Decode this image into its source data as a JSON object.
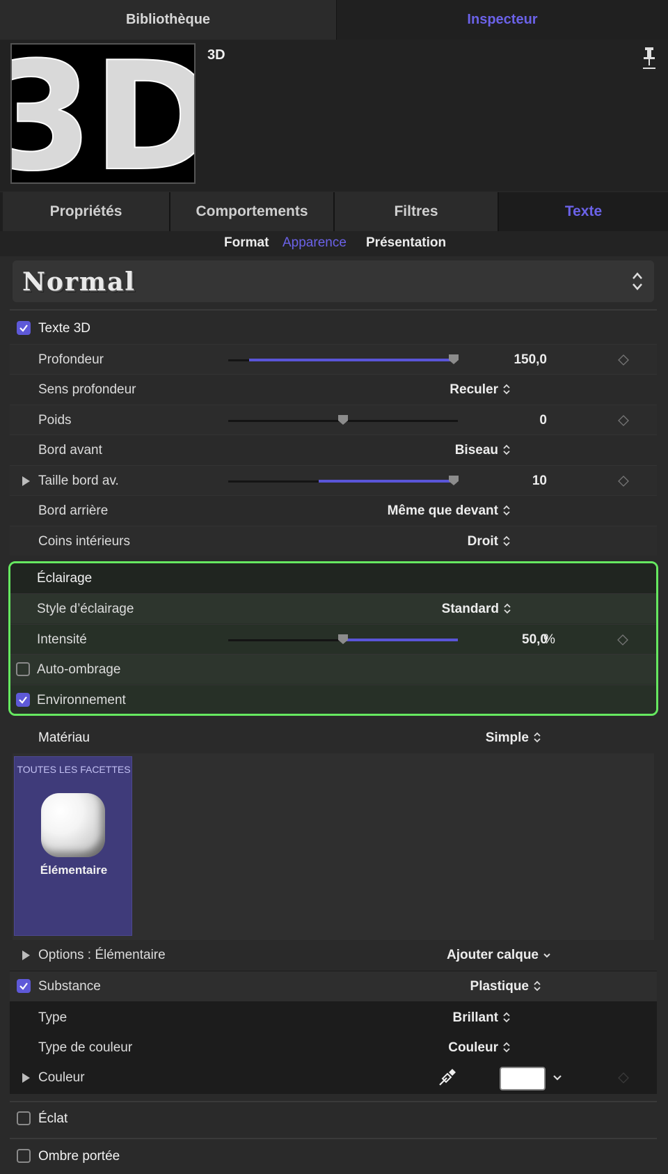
{
  "top_tabs": {
    "library": "Bibliothèque",
    "inspector": "Inspecteur"
  },
  "header": {
    "name": "3D",
    "thumbnail_text": "3D"
  },
  "inspector_tabs": [
    "Propriétés",
    "Comportements",
    "Filtres",
    "Texte"
  ],
  "sub_tabs": [
    "Format",
    "Apparence",
    "Présentation"
  ],
  "preset": {
    "label": "Normal"
  },
  "text3d": {
    "label": "Texte 3D",
    "checked": true,
    "depth": {
      "label": "Profondeur",
      "value": "150,0",
      "fraction": 0.98
    },
    "depth_dir": {
      "label": "Sens profondeur",
      "value": "Reculer"
    },
    "weight": {
      "label": "Poids",
      "value": "0",
      "fraction": 0.5
    },
    "front_edge": {
      "label": "Bord avant",
      "value": "Biseau"
    },
    "front_edge_size": {
      "label": "Taille bord av.",
      "value": "10",
      "fraction": 0.98,
      "fill_from": 0.4
    },
    "back_edge": {
      "label": "Bord arrière",
      "value": "Même que devant"
    },
    "inner_corners": {
      "label": "Coins intérieurs",
      "value": "Droit"
    }
  },
  "lighting": {
    "label": "Éclairage",
    "style": {
      "label": "Style d’éclairage",
      "value": "Standard"
    },
    "intensity": {
      "label": "Intensité",
      "value": "50,0",
      "unit": "%",
      "fraction": 0.5
    },
    "self_shadows": {
      "label": "Auto-ombrage",
      "checked": false
    },
    "environment": {
      "label": "Environnement",
      "checked": true
    }
  },
  "material": {
    "label": "Matériau",
    "value": "Simple",
    "card_top": "TOUTES LES FACETTES",
    "card_name": "Élémentaire",
    "options_label": "Options : Élémentaire",
    "add_layer": "Ajouter calque"
  },
  "substance": {
    "label": "Substance",
    "checked": true,
    "value": "Plastique",
    "type": {
      "label": "Type",
      "value": "Brillant"
    },
    "color_type": {
      "label": "Type de couleur",
      "value": "Couleur"
    },
    "color": {
      "label": "Couleur",
      "swatch": "#ffffff"
    }
  },
  "glow": {
    "label": "Éclat",
    "checked": false
  },
  "drop_shadow": {
    "label": "Ombre portée",
    "checked": false
  },
  "colors": {
    "accent": "#6b62e8",
    "highlight_border": "#66e860"
  }
}
